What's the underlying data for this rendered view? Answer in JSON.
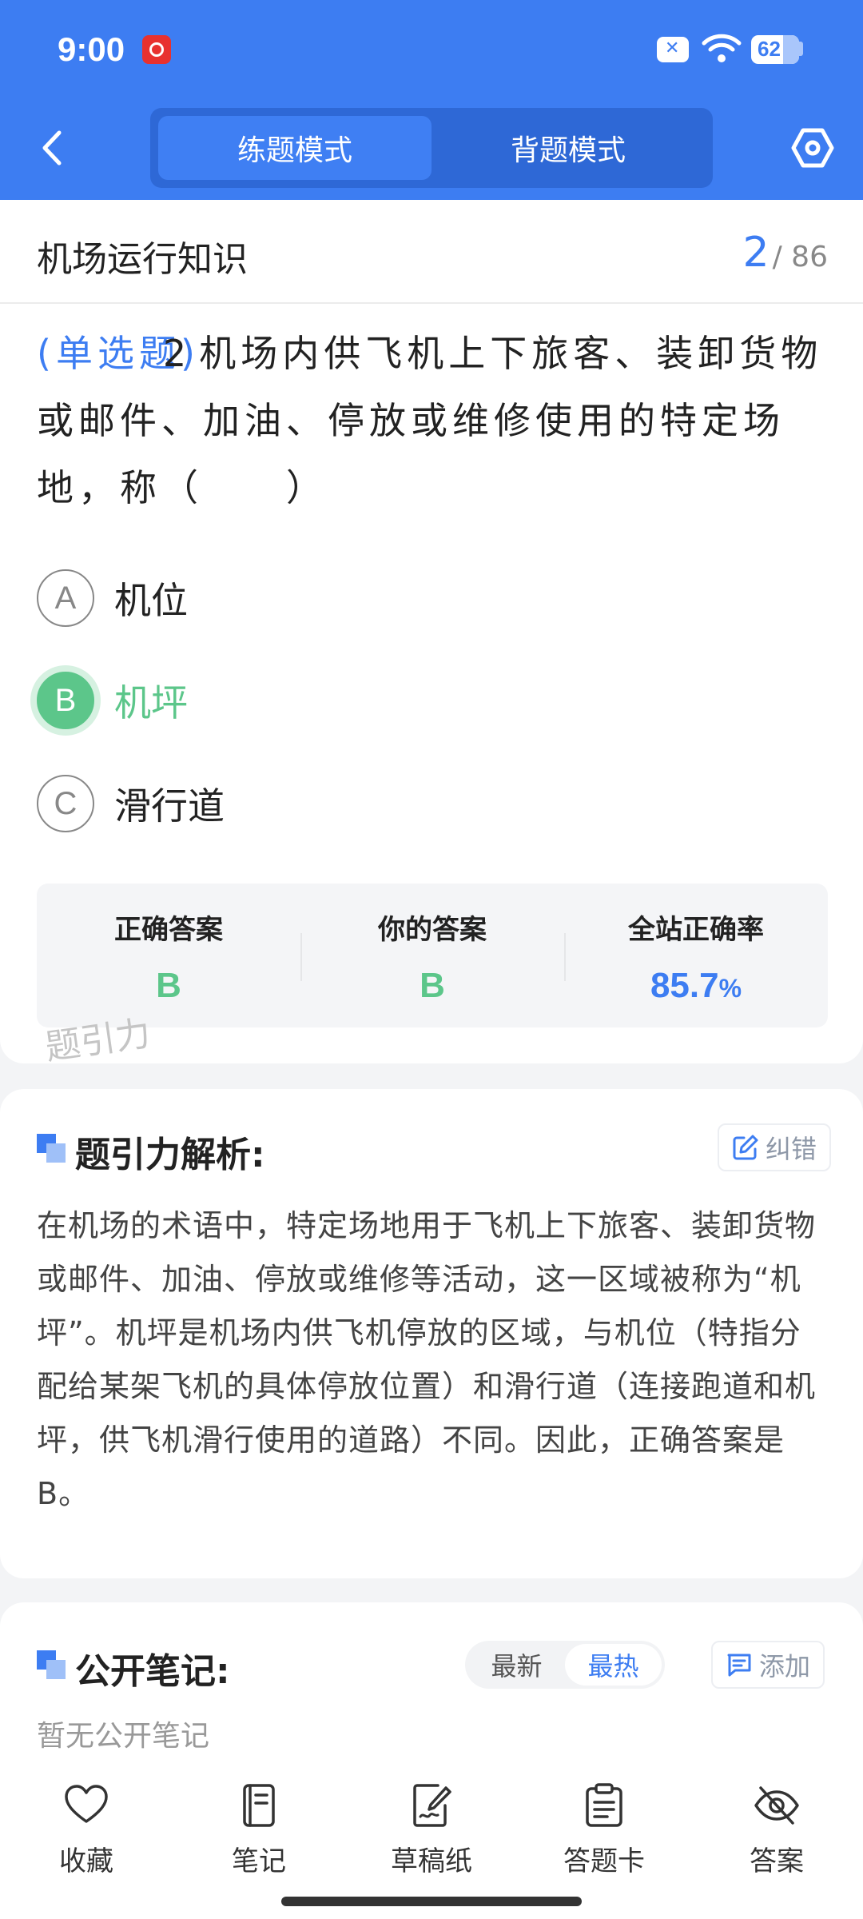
{
  "status": {
    "time": "9:00",
    "battery": "62"
  },
  "header": {
    "tabs": [
      {
        "label": "练题模式",
        "active": true
      },
      {
        "label": "背题模式",
        "active": false
      }
    ]
  },
  "chapter": {
    "title": "机场运行知识",
    "current": "2",
    "total": "/ 86"
  },
  "question": {
    "type": "(单选题)",
    "number": "2",
    "text": "机场内供飞机上下旅客、装卸货物或邮件、加油、停放或维修使用的特定场地，称（　　）"
  },
  "options": [
    {
      "letter": "A",
      "text": "机位"
    },
    {
      "letter": "B",
      "text": "机坪"
    },
    {
      "letter": "C",
      "text": "滑行道"
    }
  ],
  "answer": {
    "correct_label": "正确答案",
    "correct_value": "B",
    "yours_label": "你的答案",
    "yours_value": "B",
    "rate_label": "全站正确率",
    "rate_value": "85.7",
    "rate_unit": "%"
  },
  "watermark": "题引力",
  "analysis": {
    "title": "题引力解析:",
    "report_label": "纠错",
    "text": "在机场的术语中，特定场地用于飞机上下旅客、装卸货物或邮件、加油、停放或维修等活动，这一区域被称为“机坪”。机坪是机场内供飞机停放的区域，与机位（特指分配给某架飞机的具体停放位置）和滑行道（连接跑道和机坪，供飞机滑行使用的道路）不同。因此，正确答案是B。"
  },
  "notes": {
    "title": "公开笔记:",
    "sort_options": [
      "最新",
      "最热"
    ],
    "add_label": "添加",
    "empty_text": "暂无公开笔记"
  },
  "bottom_nav": [
    {
      "label": "收藏",
      "icon": "heart-icon"
    },
    {
      "label": "笔记",
      "icon": "notebook-icon"
    },
    {
      "label": "草稿纸",
      "icon": "draft-paper-icon"
    },
    {
      "label": "答题卡",
      "icon": "answer-card-icon"
    },
    {
      "label": "答案",
      "icon": "eye-off-icon"
    }
  ],
  "colors": {
    "primary": "#3d7df2",
    "correct": "#5cc68a"
  }
}
